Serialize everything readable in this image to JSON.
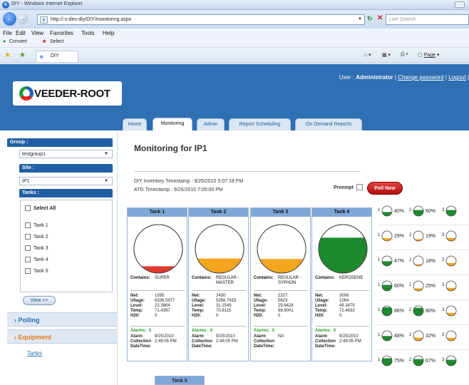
{
  "window": {
    "title": "DIY - Windows Internet Explorer"
  },
  "address": {
    "url": "http://-s-dev-diy/DIY/monitoring.aspx",
    "search_placeholder": "Live Search"
  },
  "menu": [
    "File",
    "Edit",
    "View",
    "Favorites",
    "Tools",
    "Help"
  ],
  "links": {
    "convert": "Convert",
    "select": "Select"
  },
  "favorites_tab": {
    "label": "DIY"
  },
  "favtools": {
    "page": "Page"
  },
  "header": {
    "brand": "VEEDER-ROOT",
    "user_prefix": "User :",
    "user": "Administrator",
    "change_password": "Change password",
    "logout": "Logout",
    "separator": "|"
  },
  "tabs": [
    "Home",
    "Monitoring",
    "Admin",
    "Report Scheduling",
    "On Demand Reports"
  ],
  "active_tab": "Monitoring",
  "sidebar": {
    "group_label": "Group :",
    "group_value": "testgroup1",
    "site_label": "Site :",
    "site_value": "IP1",
    "tanks_label": "Tanks :",
    "select_all": "Select All",
    "tanks": [
      "Tank 1",
      "Tank 2",
      "Tank 3",
      "Tank 4",
      "Tank 5"
    ],
    "view_button": "View >>",
    "polling": "Polling",
    "equipment": "Equipment",
    "equipment_link": "Tanks"
  },
  "main": {
    "title": "Monitoring for  IP1",
    "diy_timestamp": "DIY Inventory Timestamp : 9/25/2010 5:07:18 PM",
    "atg_timestamp": "ATG Timestamp : 9/25/2010 7:05:00 PM",
    "preempt_label": "Preempt",
    "poll_now": "Poll Now"
  },
  "tank_cards": [
    {
      "name": "Tank 1",
      "contains_label": "Contains:",
      "product": "SUPER",
      "fill": 0.14,
      "color": "#e23a2e",
      "net_label": "Net:",
      "net": "1595",
      "ullage_label": "Ullage:",
      "ullage": "6336.5977",
      "level_label": "Level:",
      "level": "22.3864",
      "temp_label": "Temp:",
      "temp": "71.4397",
      "h2o_label": "H20:",
      "h2o": "0",
      "alarms_label": "Alarms:",
      "alarms": "0",
      "collection_label1": "Alarm",
      "collection_label2": "Collection",
      "collection_label3": "DateTime:",
      "collection_date": "9/25/2010",
      "collection_time": "2:49:05 PM"
    },
    {
      "name": "Tank 2",
      "contains_label": "Contains:",
      "product": "REGULAR - MASTER",
      "fill": 0.3,
      "color": "#f4a51e",
      "net_label": "Net:",
      "net": "2430",
      "ullage_label": "Ullage:",
      "ullage": "5356.7915",
      "level_label": "Level:",
      "level": "31.1545",
      "temp_label": "Temp:",
      "temp": "70.6115",
      "h2o_label": "H20:",
      "h2o": "0",
      "alarms_label": "Alarms:",
      "alarms": "0",
      "collection_label1": "Alarm",
      "collection_label2": "Collection",
      "collection_label3": "DateTime:",
      "collection_date": "9/25/2010",
      "collection_time": "2:49:05 PM"
    },
    {
      "name": "Tank 3",
      "contains_label": "Contains:",
      "product": "REGULAR - SYPHON",
      "fill": 0.29,
      "color": "#f4a51e",
      "net_label": "Net:",
      "net": "2327",
      "ullage_label": "Ullage:",
      "ullage": "5623",
      "level_label": "Level:",
      "level": "29.6428",
      "temp_label": "Temp:",
      "temp": "68.6001",
      "h2o_label": "H20:",
      "h2o": "0",
      "alarms_label": "Alarms:",
      "alarms": "0",
      "collection_label1": "Alarm",
      "collection_label2": "Collection",
      "collection_label3": "DateTime:",
      "collection_date": "NA",
      "collection_time": ""
    },
    {
      "name": "Tank 4",
      "contains_label": "Contains:",
      "product": "KEROSENE",
      "fill": 0.73,
      "color": "#1d8a2e",
      "net_label": "Net:",
      "net": "3006",
      "ullage_label": "Ullage:",
      "ullage": "1064",
      "level_label": "Level:",
      "level": "49.3479",
      "temp_label": "Temp:",
      "temp": "72.4633",
      "h2o_label": "H20:",
      "h2o": "0",
      "alarms_label": "Alarms:",
      "alarms": "0",
      "collection_label1": "Alarm",
      "collection_label2": "Collection",
      "collection_label3": "DateTime:",
      "collection_date": "9/25/2010",
      "collection_time": "2:49:05 PM"
    }
  ],
  "tank5_label": "Tank 5",
  "gauge_rows": [
    [
      {
        "n": "1",
        "pct": "40%",
        "fill": 0.4,
        "color": "#1d8a2e"
      },
      {
        "n": "2",
        "pct": "60%",
        "fill": 0.6,
        "color": "#1d8a2e"
      },
      {
        "n": "3",
        "pct": "",
        "fill": 0.6,
        "color": "#1d8a2e"
      }
    ],
    [
      {
        "n": "1",
        "pct": "29%",
        "fill": 0.29,
        "color": "#f4a51e"
      },
      {
        "n": "2",
        "pct": "19%",
        "fill": 0.19,
        "color": "#f4a51e"
      },
      {
        "n": "3",
        "pct": "",
        "fill": 0.3,
        "color": "#f4a51e"
      }
    ],
    [
      {
        "n": "1",
        "pct": "47%",
        "fill": 0.47,
        "color": "#1d8a2e"
      },
      {
        "n": "2",
        "pct": "18%",
        "fill": 0.18,
        "color": "#f4a51e"
      },
      {
        "n": "3",
        "pct": "",
        "fill": 0.3,
        "color": "#f4a51e"
      }
    ],
    [
      {
        "n": "1",
        "pct": "60%",
        "fill": 0.6,
        "color": "#1d8a2e"
      },
      {
        "n": "2",
        "pct": "25%",
        "fill": 0.25,
        "color": "#f4a51e"
      },
      {
        "n": "3",
        "pct": "",
        "fill": 0.3,
        "color": "#f4a51e"
      }
    ],
    [
      {
        "n": "1",
        "pct": "86%",
        "fill": 0.86,
        "color": "#1d8a2e"
      },
      {
        "n": "2",
        "pct": "80%",
        "fill": 0.8,
        "color": "#1d8a2e"
      },
      {
        "n": "3",
        "pct": "",
        "fill": 0.3,
        "color": "#f4a51e"
      }
    ],
    [
      {
        "n": "1",
        "pct": "48%",
        "fill": 0.48,
        "color": "#1d8a2e"
      },
      {
        "n": "2",
        "pct": "32%",
        "fill": 0.32,
        "color": "#f4a51e"
      },
      {
        "n": "3",
        "pct": "",
        "fill": 0.3,
        "color": "#f4a51e"
      }
    ],
    [
      {
        "n": "1",
        "pct": "75%",
        "fill": 0.75,
        "color": "#1d8a2e"
      },
      {
        "n": "2",
        "pct": "67%",
        "fill": 0.67,
        "color": "#1d8a2e"
      },
      {
        "n": "3",
        "pct": "",
        "fill": 0.6,
        "color": "#1d8a2e"
      }
    ]
  ],
  "colors": {
    "header": "#2f6fb3",
    "accent": "#215fa5",
    "poll_now": "#c81818",
    "equipment": "#e37b1a"
  }
}
